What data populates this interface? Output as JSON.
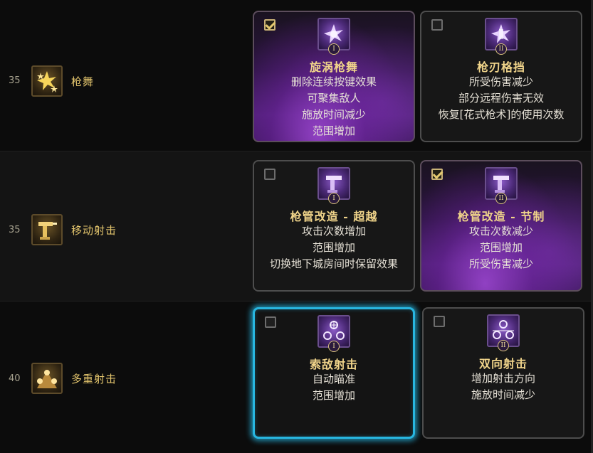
{
  "rows": [
    {
      "level": "35",
      "skill": "枪舞",
      "skill_icon": "gun-dance-icon",
      "options": [
        {
          "title": "旋涡枪舞",
          "desc": [
            "删除连续按键效果",
            "可聚集敌人",
            "施放时间减少",
            "范围增加"
          ],
          "checked": true,
          "badge": "I",
          "icon": "whirlwind-gun-dance-icon"
        },
        {
          "title": "枪刃格挡",
          "desc": [
            "所受伤害减少",
            "部分远程伤害无效",
            "恢复[花式枪术]的使用次数"
          ],
          "checked": false,
          "badge": "II",
          "icon": "gunblade-block-icon"
        }
      ]
    },
    {
      "level": "35",
      "skill": "移动射击",
      "skill_icon": "moving-shot-icon",
      "options": [
        {
          "title": "枪管改造 - 超越",
          "desc": [
            "攻击次数增加",
            "范围增加",
            "切换地下城房间时保留效果"
          ],
          "checked": false,
          "badge": "I",
          "icon": "barrel-mod-surpass-icon"
        },
        {
          "title": "枪管改造 - 节制",
          "desc": [
            "攻击次数减少",
            "范围增加",
            "所受伤害减少"
          ],
          "checked": true,
          "badge": "II",
          "icon": "barrel-mod-restraint-icon"
        }
      ]
    },
    {
      "level": "40",
      "skill": "多重射击",
      "skill_icon": "multi-shot-icon",
      "options": [
        {
          "title": "索敌射击",
          "desc": [
            "自动瞄准",
            "范围增加"
          ],
          "checked": false,
          "badge": "I",
          "icon": "seek-shot-icon"
        },
        {
          "title": "双向射击",
          "desc": [
            "增加射击方向",
            "施放时间减少"
          ],
          "checked": false,
          "badge": "II",
          "icon": "bidirectional-shot-icon"
        }
      ]
    }
  ],
  "colors": {
    "selected_purple": "#7a34b4",
    "focus_cyan": "#28b6e0",
    "title_gold": "#f0d48a",
    "skill_gold": "#e3c56d"
  }
}
